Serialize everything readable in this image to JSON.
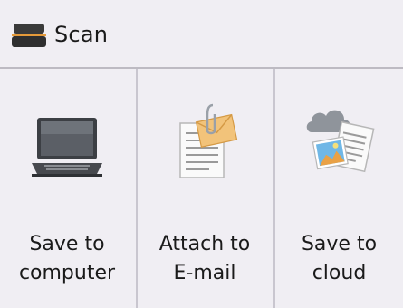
{
  "header": {
    "title": "Scan",
    "icon": "scanner-icon"
  },
  "tiles": [
    {
      "name": "save-to-computer",
      "icon": "laptop-icon",
      "line1": "Save to",
      "line2": "computer"
    },
    {
      "name": "attach-to-email",
      "icon": "email-attachment-icon",
      "line1": "Attach to",
      "line2": "E-mail"
    },
    {
      "name": "save-to-cloud",
      "icon": "cloud-photo-icon",
      "line1": "Save to",
      "line2": "cloud"
    }
  ],
  "colors": {
    "background": "#f0eef3",
    "divider": "#c9c6cf",
    "text": "#1a1a1a"
  }
}
